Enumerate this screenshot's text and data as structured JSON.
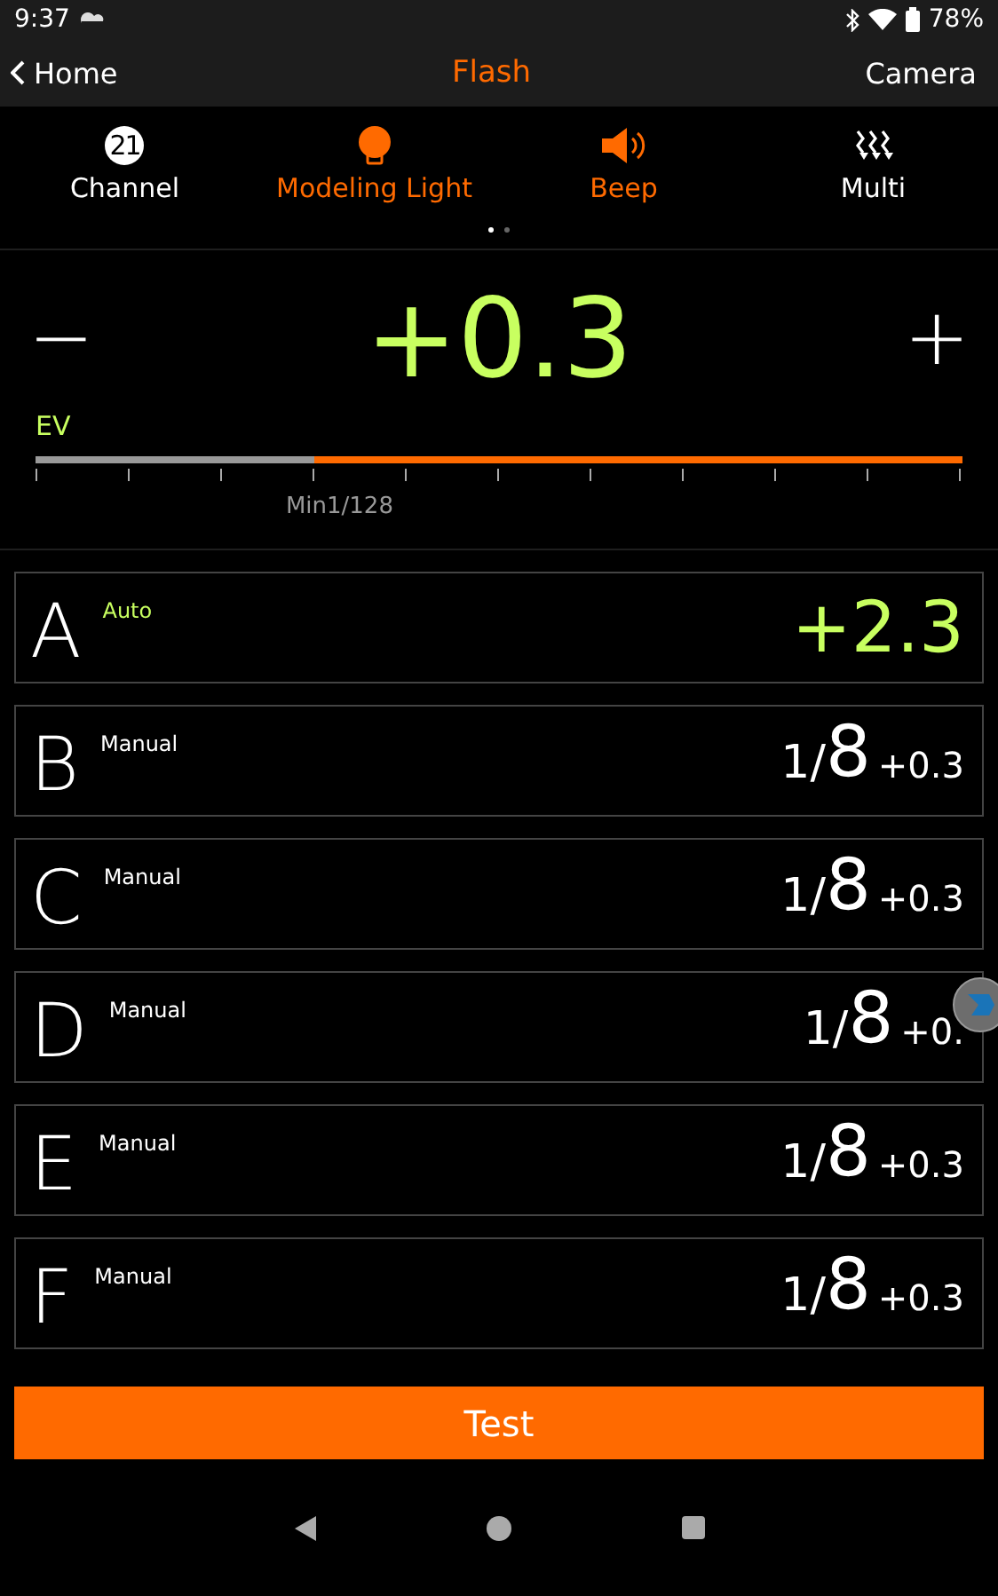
{
  "status_bar": {
    "time": "9:37",
    "battery": "78%"
  },
  "nav": {
    "back": "Home",
    "title": "Flash",
    "action": "Camera"
  },
  "tabs": [
    {
      "kind": "channel",
      "label": "Channel",
      "badge": "21",
      "on": false
    },
    {
      "kind": "bulb",
      "label": "Modeling Light",
      "on": true
    },
    {
      "kind": "speaker",
      "label": "Beep",
      "on": true
    },
    {
      "kind": "multi",
      "label": "Multi",
      "on": false
    }
  ],
  "pages": [
    {
      "selected": true
    },
    {
      "selected": false
    }
  ],
  "ev": {
    "minus": "−",
    "value": "+0.3",
    "plus": "+",
    "unit": "EV",
    "level": 0.3,
    "min_label": "Min1/128"
  },
  "groups": [
    {
      "letter": "A",
      "mode": "Auto",
      "kind": "auto",
      "value": "+2.3"
    },
    {
      "letter": "B",
      "mode": "Manual",
      "kind": "manual",
      "fraction": "1/",
      "power": "8",
      "comp": "+0.3"
    },
    {
      "letter": "C",
      "mode": "Manual",
      "kind": "manual",
      "fraction": "1/",
      "power": "8",
      "comp": "+0.3"
    },
    {
      "letter": "D",
      "mode": "Manual",
      "kind": "manual",
      "fraction": "1/",
      "power": "8",
      "comp": "+0."
    },
    {
      "letter": "E",
      "mode": "Manual",
      "kind": "manual",
      "fraction": "1/",
      "power": "8",
      "comp": "+0.3"
    },
    {
      "letter": "F",
      "mode": "Manual",
      "kind": "manual",
      "fraction": "1/",
      "power": "8",
      "comp": "+0.3"
    }
  ],
  "test_button": "Test"
}
